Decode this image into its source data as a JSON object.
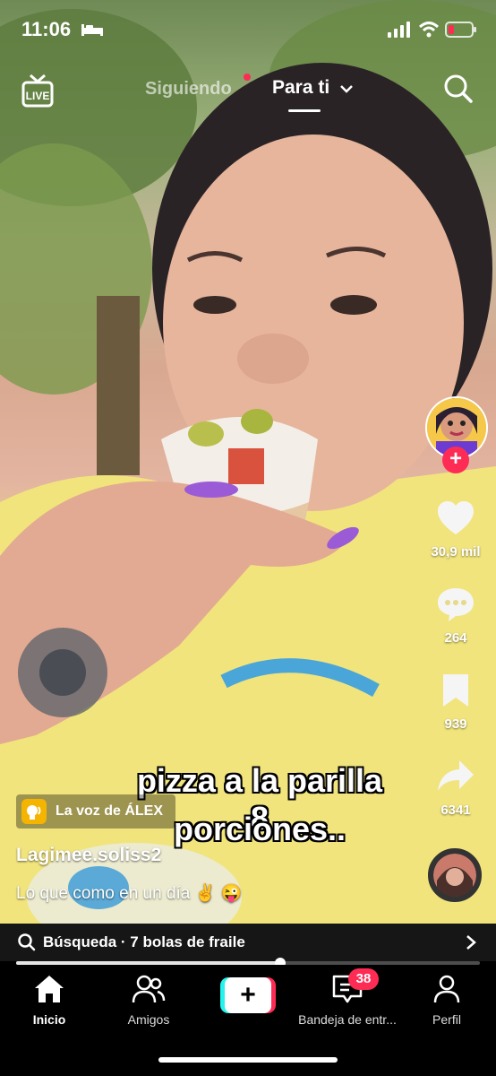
{
  "status_bar": {
    "time": "11:06"
  },
  "top_nav": {
    "following": "Siguiendo",
    "for_you": "Para ti"
  },
  "video": {
    "overlay_line1": "pizza a la parilla 8",
    "overlay_line2": "porciones..",
    "voice_label": "La voz de ÁLEX",
    "username": "Lagimee.soliss2",
    "description": "Lo que como en un día ✌️ 😜"
  },
  "actions": {
    "likes": "30,9 mil",
    "comments": "264",
    "saves": "939",
    "shares": "6341"
  },
  "search_bar": {
    "text": "Búsqueda · 7 bolas de fraile"
  },
  "progress": {
    "fraction": 0.57
  },
  "bottom_nav": {
    "home": "Inicio",
    "friends": "Amigos",
    "inbox": "Bandeja de entr...",
    "inbox_badge": "38",
    "profile": "Perfil"
  },
  "colors": {
    "accent": "#fe2c55",
    "cyan": "#25f4ee",
    "voice_icon": "#f4b400"
  }
}
